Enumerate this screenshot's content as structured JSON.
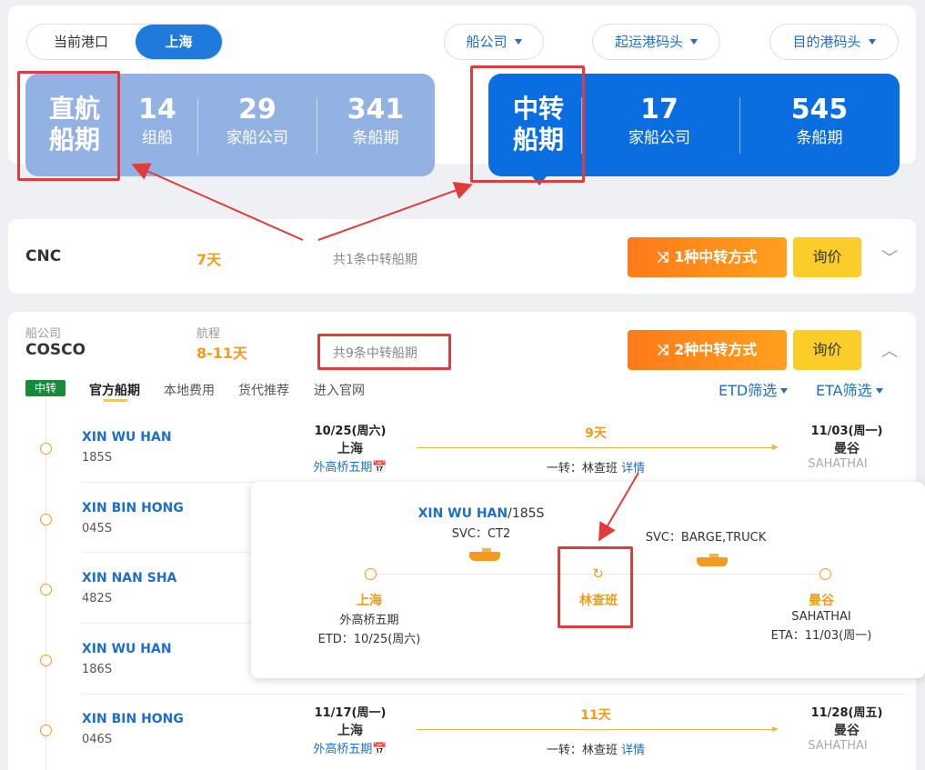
{
  "header": {
    "port_label": "当前港口",
    "port_value": "上海",
    "filters": [
      "船公司",
      "起运港码头",
      "目的港码头"
    ]
  },
  "direct": {
    "title_line1": "直航",
    "title_line2": "船期",
    "stats": [
      {
        "num": "14",
        "label": "组船"
      },
      {
        "num": "29",
        "label": "家船公司"
      },
      {
        "num": "341",
        "label": "条船期"
      }
    ]
  },
  "transfer": {
    "title_line1": "中转",
    "title_line2": "船期",
    "stats": [
      {
        "num": "17",
        "label": "家船公司"
      },
      {
        "num": "545",
        "label": "条船期"
      }
    ]
  },
  "cnc": {
    "name": "CNC",
    "duration": "7天",
    "count": "共1条中转船期",
    "route_btn": "1种中转方式",
    "quote_btn": "询价"
  },
  "cosco": {
    "carrier_label": "船公司",
    "name": "COSCO",
    "duration_label": "航程",
    "duration": "8-11天",
    "count": "共9条中转船期",
    "route_btn": "2种中转方式",
    "quote_btn": "询价",
    "badge": "中转",
    "tabs": [
      "官方船期",
      "本地费用",
      "货代推荐",
      "进入官网"
    ],
    "etd_filter": "ETD筛选",
    "eta_filter": "ETA筛选"
  },
  "schedules": [
    {
      "vessel": "XIN WU HAN",
      "voyage": "185S",
      "etd": "10/25(周六)",
      "origin": "上海",
      "terminal": "外高桥五期",
      "days": "9天",
      "via_prefix": "一转：",
      "via": "林查班",
      "detail": "详情",
      "eta": "11/03(周一)",
      "dest": "曼谷",
      "dest_terminal": "SAHATHAI"
    },
    {
      "vessel": "XIN BIN HONG",
      "voyage": "045S"
    },
    {
      "vessel": "XIN NAN SHA",
      "voyage": "482S"
    },
    {
      "vessel": "XIN WU HAN",
      "voyage": "186S"
    },
    {
      "vessel": "XIN BIN HONG",
      "voyage": "046S",
      "etd": "11/17(周一)",
      "origin": "上海",
      "terminal": "外高桥五期",
      "days": "11天",
      "via_prefix": "一转：",
      "via": "林查班",
      "detail": "详情",
      "eta": "11/28(周五)",
      "dest": "曼谷",
      "dest_terminal": "SAHATHAI"
    }
  ],
  "popup": {
    "vessel": "XIN WU HAN",
    "voyage": "/185S",
    "svc1": "SVC：CT2",
    "svc2": "SVC：BARGE,TRUCK",
    "origin": "上海",
    "origin_terminal": "外高桥五期",
    "etd": "ETD：10/25(周六)",
    "transit": "林查班",
    "dest": "曼谷",
    "dest_terminal": "SAHATHAI",
    "eta": "ETA：11/03(周一)"
  },
  "colors": {
    "accent_blue": "#0a6ee0",
    "light_blue": "#92b2e3",
    "orange": "#f39b1a",
    "annotation_red": "#e03c3c"
  }
}
